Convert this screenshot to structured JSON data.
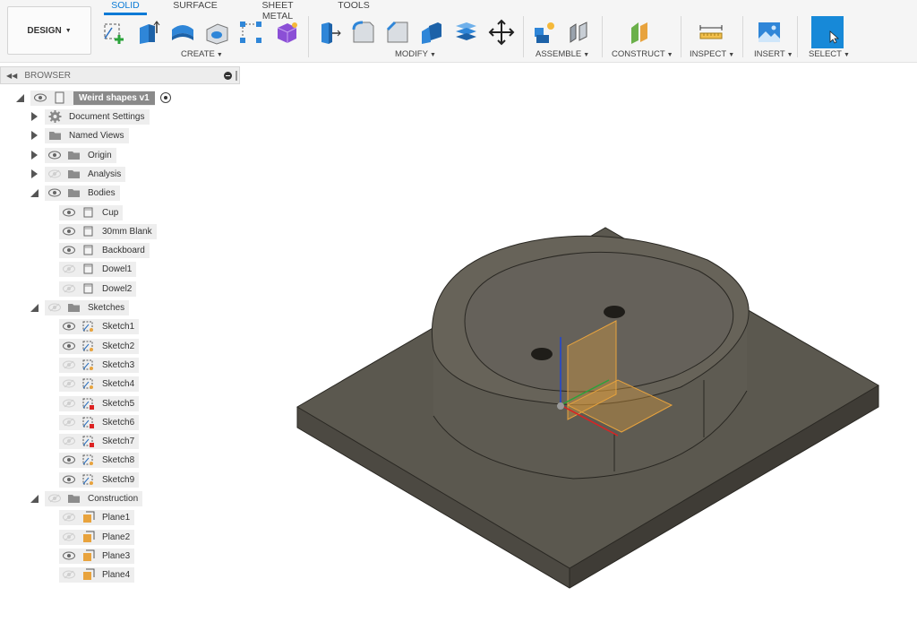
{
  "workspace": {
    "label": "DESIGN"
  },
  "tabs": [
    {
      "label": "SOLID",
      "active": true
    },
    {
      "label": "SURFACE",
      "active": false
    },
    {
      "label": "SHEET METAL",
      "active": false
    },
    {
      "label": "TOOLS",
      "active": false
    }
  ],
  "groups": {
    "create": "CREATE",
    "modify": "MODIFY",
    "assemble": "ASSEMBLE",
    "construct": "CONSTRUCT",
    "inspect": "INSPECT",
    "insert": "INSERT",
    "select": "SELECT"
  },
  "browser": {
    "title": "BROWSER",
    "root": "Weird shapes v1",
    "top_items": [
      {
        "label": "Document Settings",
        "icon": "gear-icon"
      },
      {
        "label": "Named Views",
        "icon": "folder-icon"
      },
      {
        "label": "Origin",
        "icon": "folder-icon",
        "visible": true
      },
      {
        "label": "Analysis",
        "icon": "folder-icon",
        "visible": false
      },
      {
        "label": "Bodies",
        "icon": "folder-icon",
        "visible": true,
        "expanded": true
      }
    ],
    "bodies": [
      {
        "label": "Cup",
        "visible": true
      },
      {
        "label": "30mm Blank",
        "visible": true
      },
      {
        "label": "Backboard",
        "visible": true
      },
      {
        "label": "Dowel1",
        "visible": false
      },
      {
        "label": "Dowel2",
        "visible": false
      }
    ],
    "sketches_folder": {
      "label": "Sketches",
      "visible": false,
      "expanded": true
    },
    "sketches": [
      {
        "label": "Sketch1",
        "visible": true,
        "locked": false
      },
      {
        "label": "Sketch2",
        "visible": true,
        "locked": false
      },
      {
        "label": "Sketch3",
        "visible": false,
        "locked": false
      },
      {
        "label": "Sketch4",
        "visible": false,
        "locked": false
      },
      {
        "label": "Sketch5",
        "visible": false,
        "locked": true
      },
      {
        "label": "Sketch6",
        "visible": false,
        "locked": true
      },
      {
        "label": "Sketch7",
        "visible": false,
        "locked": true
      },
      {
        "label": "Sketch8",
        "visible": true,
        "locked": false
      },
      {
        "label": "Sketch9",
        "visible": true,
        "locked": false
      }
    ],
    "construction_folder": {
      "label": "Construction",
      "visible": false,
      "expanded": true
    },
    "planes": [
      {
        "label": "Plane1",
        "visible": false
      },
      {
        "label": "Plane2",
        "visible": false
      },
      {
        "label": "Plane3",
        "visible": true
      },
      {
        "label": "Plane4",
        "visible": false
      }
    ]
  },
  "colors": {
    "accent": "#0a7ad6",
    "model_top": "#5a574d",
    "model_side": "#4a463d",
    "plane_orange": "#e8a33d"
  }
}
